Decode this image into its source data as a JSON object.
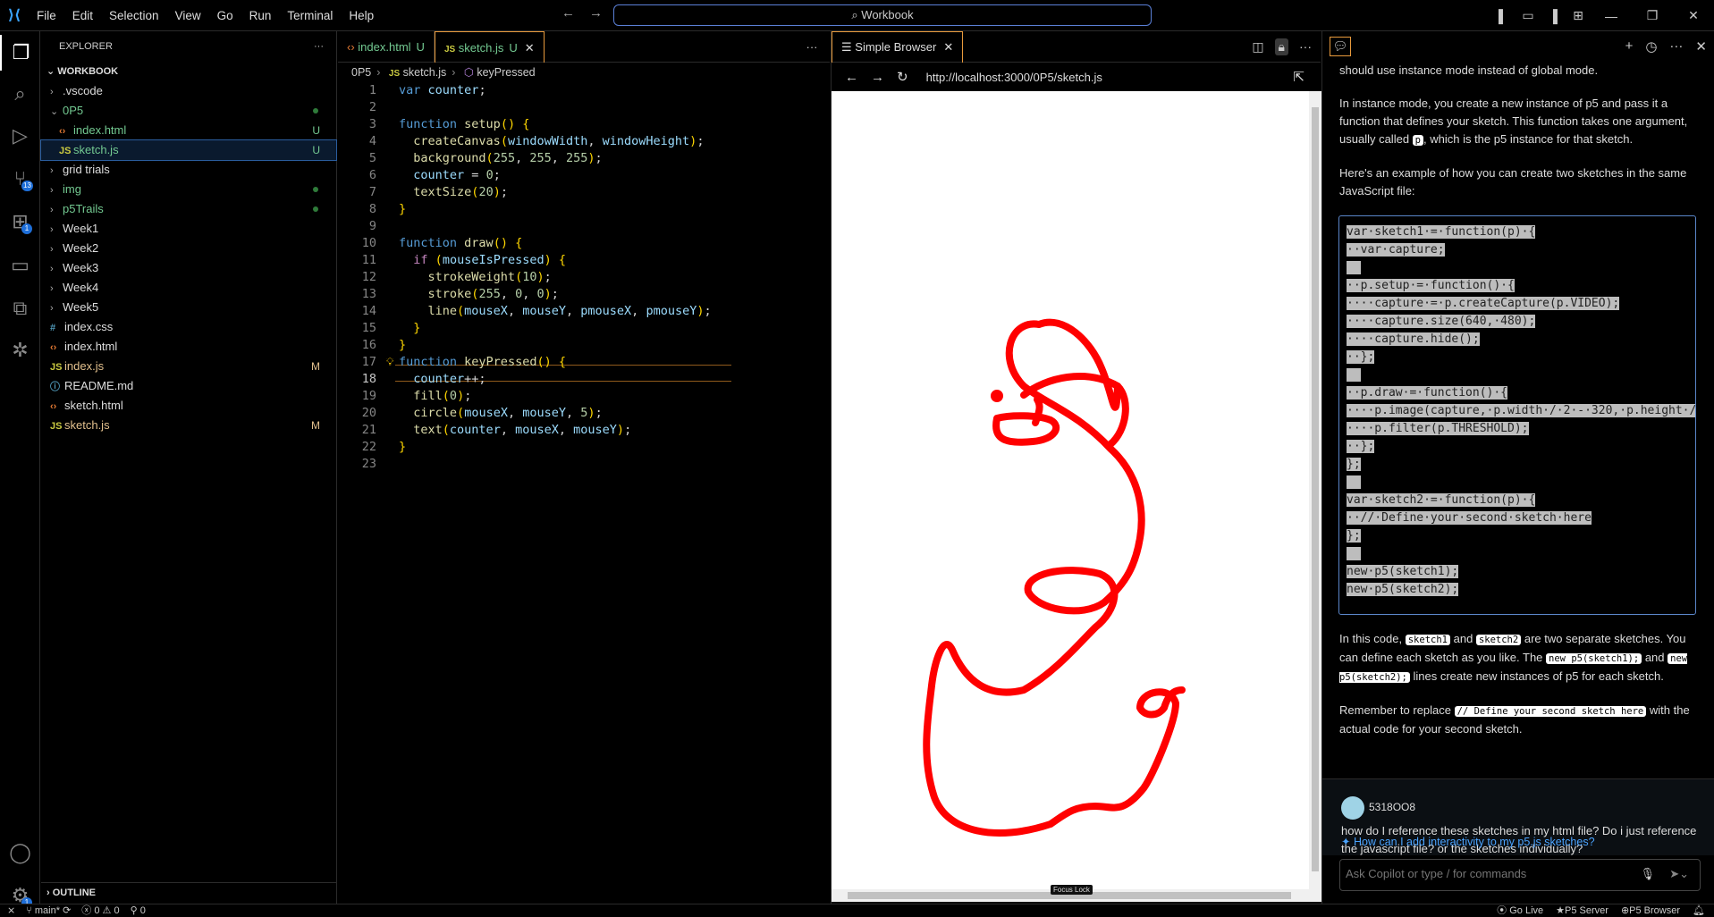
{
  "titlebar": {
    "menu": [
      "File",
      "Edit",
      "Selection",
      "View",
      "Go",
      "Run",
      "Terminal",
      "Help"
    ],
    "search": "Workbook"
  },
  "explorer": {
    "title": "EXPLORER",
    "workspace": "WORKBOOK",
    "items": [
      {
        "label": ".vscode",
        "type": "folder",
        "depth": 1,
        "open": false,
        "color": "white"
      },
      {
        "label": "0P5",
        "type": "folder",
        "depth": 1,
        "open": true,
        "color": "green",
        "dot": true
      },
      {
        "label": "index.html",
        "type": "html",
        "depth": 2,
        "color": "green",
        "status": "U"
      },
      {
        "label": "sketch.js",
        "type": "js",
        "depth": 2,
        "color": "green",
        "status": "U",
        "selected": true
      },
      {
        "label": "grid trials",
        "type": "folder",
        "depth": 1,
        "open": false,
        "color": "white"
      },
      {
        "label": "img",
        "type": "folder",
        "depth": 1,
        "open": false,
        "color": "green",
        "dot": true
      },
      {
        "label": "p5Trails",
        "type": "folder",
        "depth": 1,
        "open": false,
        "color": "green",
        "dot": true
      },
      {
        "label": "Week1",
        "type": "folder",
        "depth": 1,
        "open": false,
        "color": "white"
      },
      {
        "label": "Week2",
        "type": "folder",
        "depth": 1,
        "open": false,
        "color": "white"
      },
      {
        "label": "Week3",
        "type": "folder",
        "depth": 1,
        "open": false,
        "color": "white"
      },
      {
        "label": "Week4",
        "type": "folder",
        "depth": 1,
        "open": false,
        "color": "white"
      },
      {
        "label": "Week5",
        "type": "folder",
        "depth": 1,
        "open": false,
        "color": "white"
      },
      {
        "label": "index.css",
        "type": "css",
        "depth": 1,
        "color": "white"
      },
      {
        "label": "index.html",
        "type": "html",
        "depth": 1,
        "color": "white"
      },
      {
        "label": "index.js",
        "type": "js",
        "depth": 1,
        "color": "yellow",
        "status": "M"
      },
      {
        "label": "README.md",
        "type": "md",
        "depth": 1,
        "color": "white"
      },
      {
        "label": "sketch.html",
        "type": "html",
        "depth": 1,
        "color": "white"
      },
      {
        "label": "sketch.js",
        "type": "js",
        "depth": 1,
        "color": "yellow",
        "status": "M"
      }
    ],
    "outline": "OUTLINE"
  },
  "editor": {
    "tabs": [
      {
        "label": "index.html",
        "status": "U"
      },
      {
        "label": "sketch.js",
        "status": "U"
      }
    ],
    "breadcrumb": [
      "0P5",
      "sketch.js",
      "keyPressed"
    ],
    "current_line": 18,
    "lines": [
      "var counter;",
      "",
      "function setup() {",
      "  createCanvas(windowWidth, windowHeight);",
      "  background(255, 255, 255);",
      "  counter = 0;",
      "  textSize(20);",
      "}",
      "",
      "function draw() {",
      "  if (mouseIsPressed) {",
      "    strokeWeight(10);",
      "    stroke(255, 0, 0);",
      "    line(mouseX, mouseY, pmouseX, pmouseY);",
      "  }",
      "}",
      "function keyPressed() {",
      "  counter++;",
      "  fill(0);",
      "  circle(mouseX, mouseY, 5);",
      "  text(counter, mouseX, mouseY);",
      "}",
      ""
    ]
  },
  "browser": {
    "tab": "Simple Browser",
    "url": "http://localhost:3000/0P5/sketch.js",
    "focus_lock": "Focus Lock",
    "stroke_color": "#ff0000"
  },
  "chat": {
    "intro_tail": "should use instance mode instead of global mode.",
    "para1_a": "In instance mode, you create a new instance of p5 and pass it a function that defines your sketch. This function takes one argument, usually called",
    "para1_code": "p",
    "para1_b": ", which is the p5 instance for that sketch.",
    "para2": "Here's an example of how you can create two sketches in the same JavaScript file:",
    "code": [
      "var sketch1 = function(p) {",
      "  var capture;",
      "",
      "  p.setup = function() {",
      "    capture = p.createCapture(p.VIDEO);",
      "    capture.size(640, 480);",
      "    capture.hide();",
      "  };",
      "",
      "  p.draw = function() {",
      "    p.image(capture, p.width / 2 - 320, p.height /",
      "    p.filter(p.THRESHOLD);",
      "  };",
      "};",
      "",
      "var sketch2 = function(p) {",
      "  // Define your second sketch here",
      "};",
      "",
      "new p5(sketch1);",
      "new p5(sketch2);"
    ],
    "para3_a": "In this code,",
    "para3_c1": "sketch1",
    "para3_b": "and",
    "para3_c2": "sketch2",
    "para3_c": "are two separate sketches. You can define each sketch as you like. The",
    "para3_c3": "new p5(sketch1);",
    "para3_d": "and",
    "para3_c4": "new p5(sketch2);",
    "para3_e": "lines create new instances of p5 for each sketch.",
    "para4_a": "Remember to replace",
    "para4_code": "// Define your second sketch here",
    "para4_b": "with the actual code for your second sketch.",
    "user": {
      "name": "5318OO8",
      "message": "how do I reference these sketches in my html file? Do i just reference the javascript file? or the sketches individually?"
    },
    "suggestion": "How can I add interactivity to my p5.js sketches?",
    "input_placeholder": "Ask Copilot or type / for commands"
  },
  "statusbar": {
    "branch": "main*",
    "errors": "0",
    "warnings": "0",
    "ports": "0",
    "right": [
      "Go Live",
      "P5 Server",
      "P5 Browser"
    ]
  },
  "activity": {
    "source_control_badge": "13",
    "extensions_badge": "1",
    "settings_badge": "1"
  }
}
